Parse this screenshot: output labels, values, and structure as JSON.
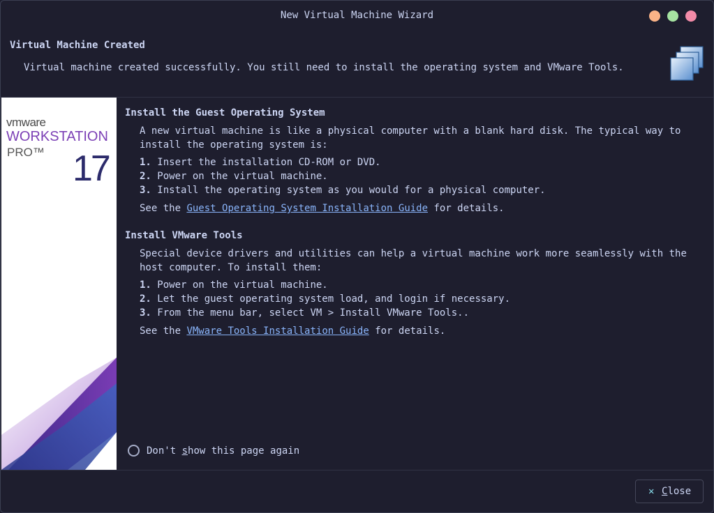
{
  "window": {
    "title": "New Virtual Machine Wizard",
    "controls": {
      "minimize": "minimize-icon",
      "maximize": "maximize-icon",
      "close": "close-icon"
    }
  },
  "header": {
    "title": "Virtual Machine Created",
    "description": "Virtual machine created successfully. You still need to install the operating system and VMware Tools.",
    "icon": "virtual-machines-icon"
  },
  "sidebar": {
    "brand": "vmware",
    "product": "WORKSTATION",
    "edition": "PRO™",
    "version": "17"
  },
  "sections": [
    {
      "title": "Install the Guest Operating System",
      "intro": "A new virtual machine is like a physical computer with a blank hard disk. The typical way to install the operating system is:",
      "steps": [
        {
          "num": "1.",
          "text": "Insert the installation CD-ROM or DVD."
        },
        {
          "num": "2.",
          "text": "Power on the virtual machine."
        },
        {
          "num": "3.",
          "text": "Install the operating system as you would for a physical computer."
        }
      ],
      "see_prefix": "See the",
      "link": "Guest Operating System Installation Guide",
      "see_suffix": "for details."
    },
    {
      "title": "Install VMware Tools",
      "intro": "Special device drivers and utilities can help a virtual machine work more seamlessly with the host computer. To install them:",
      "steps": [
        {
          "num": "1.",
          "text": "Power on the virtual machine."
        },
        {
          "num": "2.",
          "text": "Let the guest operating system load, and login if necessary."
        },
        {
          "num": "3.",
          "text": "From the menu bar, select VM > Install VMware Tools.."
        }
      ],
      "see_prefix": "See the",
      "link": "VMware Tools Installation Guide",
      "see_suffix": "for details."
    }
  ],
  "dont_show": {
    "before": "Don't ",
    "mnemonic": "s",
    "after": "how this page again",
    "checked": false
  },
  "footer": {
    "close_icon": "close-icon",
    "close_mnemonic": "C",
    "close_rest": "lose"
  },
  "colors": {
    "background": "#1e1e2e",
    "text": "#cdd6f4",
    "link": "#89b4fa",
    "brand_purple": "#7b3fb5",
    "accent_minimize": "#fab387",
    "accent_maximize": "#a6e3a1",
    "accent_close": "#f38ba8"
  }
}
